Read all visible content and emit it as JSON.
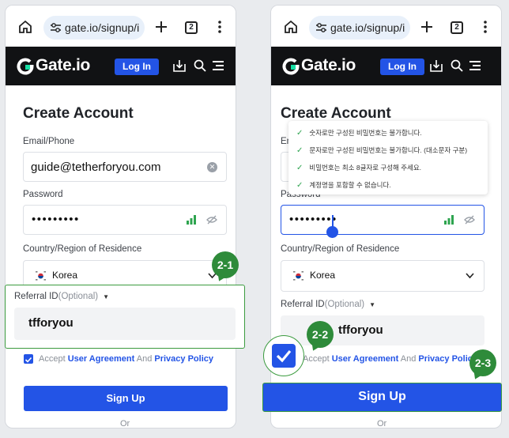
{
  "browser": {
    "url": "gate.io/signup/i",
    "tab_count": "2"
  },
  "site": {
    "logo": "Gate.io",
    "login_label": "Log In"
  },
  "form": {
    "title": "Create Account",
    "email_label": "Email/Phone",
    "email_value": "guide@tetherforyou.com",
    "password_label": "Password",
    "password_value": "•••••••••",
    "country_label": "Country/Region of Residence",
    "country_value": "Korea",
    "referral_label": "Referral ID",
    "referral_optional": "(Optional)",
    "referral_value": "tfforyou",
    "agree_prefix": "Accept",
    "agree_link1": "User Agreement",
    "agree_and": "And",
    "agree_link2": "Privacy Policy",
    "signup_label": "Sign Up",
    "or_label": "Or"
  },
  "password_rules": [
    "숫자로만 구성된 비밀번호는 불가합니다.",
    "문자로만 구성된 비밀번호는 불가합니다. (대소문자 구분)",
    "비밀번호는 최소 8글자로 구성해 주세요.",
    "계정명을 포함할 수 없습니다."
  ],
  "badges": {
    "step_2_1": "2-1",
    "step_2_2": "2-2",
    "step_2_3": "2-3"
  },
  "colors": {
    "brand_blue": "#2354e6",
    "badge_green": "#2e8b3a",
    "header_black": "#111214"
  }
}
